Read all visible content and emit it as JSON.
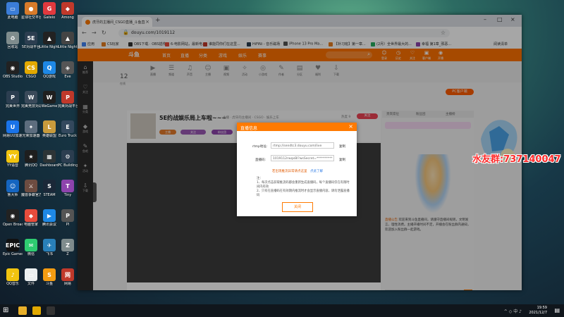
{
  "desktop_icons": [
    {
      "label": "此电脑",
      "color": "#3b7dd8",
      "glyph": "▭"
    },
    {
      "label": "星球社交平台",
      "color": "#d87b2a",
      "glyph": "●"
    },
    {
      "label": "Gateio",
      "color": "#e0393e",
      "glyph": "G"
    },
    {
      "label": "Among",
      "color": "#c0392b",
      "glyph": "◆"
    },
    {
      "label": "回收站",
      "color": "#7f8c8d",
      "glyph": "♻"
    },
    {
      "label": "5E对战平台",
      "color": "#2c3e50",
      "glyph": "5E"
    },
    {
      "label": "Little Nightmares",
      "color": "#222222",
      "glyph": "▲"
    },
    {
      "label": "Little Nightmares 2",
      "color": "#444444",
      "glyph": "▲"
    },
    {
      "label": "OBS Studio",
      "color": "#222222",
      "glyph": "◉"
    },
    {
      "label": "CSGO",
      "color": "#e2a900",
      "glyph": "CS"
    },
    {
      "label": "QQ游戏",
      "color": "#1e88e5",
      "glyph": "Q"
    },
    {
      "label": "Eve",
      "color": "#555555",
      "glyph": "◈"
    },
    {
      "label": "完美世界",
      "color": "#2c3e50",
      "glyph": "P"
    },
    {
      "label": "完美竞技对战平台",
      "color": "#3a4a5a",
      "glyph": "W"
    },
    {
      "label": "WeGame",
      "color": "#1f1f1f",
      "glyph": "W"
    },
    {
      "label": "完美对战平台",
      "color": "#c0392b",
      "glyph": "P"
    },
    {
      "label": "网易UU加速器",
      "color": "#1a73e8",
      "glyph": "U"
    },
    {
      "label": "光荣加速器",
      "color": "#5d6d7e",
      "glyph": "✦"
    },
    {
      "label": "英雄联盟",
      "color": "#c89b3c",
      "glyph": "L"
    },
    {
      "label": "Euro Truck",
      "color": "#34495e",
      "glyph": "E"
    },
    {
      "label": "YY语音",
      "color": "#f1c40f",
      "glyph": "YY"
    },
    {
      "label": "腾讯QQ",
      "color": "#1e1e1e",
      "glyph": "★"
    },
    {
      "label": "Dashboard",
      "color": "#2d3436",
      "glyph": "▦"
    },
    {
      "label": "PC Building",
      "color": "#2c3e50",
      "glyph": "⚙"
    },
    {
      "label": "鲁大师",
      "color": "#1565c0",
      "glyph": "☺"
    },
    {
      "label": "魔兽争霸官方对战平台",
      "color": "#6d4c41",
      "glyph": "⚔"
    },
    {
      "label": "STEAM",
      "color": "#1b2838",
      "glyph": "S"
    },
    {
      "label": "Tiny",
      "color": "#8e44ad",
      "glyph": "T"
    },
    {
      "label": "Open Broadcaster",
      "color": "#222222",
      "glyph": "◉"
    },
    {
      "label": "电脑管家",
      "color": "#e74c3c",
      "glyph": "◆"
    },
    {
      "label": "腾讯会议",
      "color": "#1e88e5",
      "glyph": "▶"
    },
    {
      "label": "Pl",
      "color": "#555555",
      "glyph": "P"
    },
    {
      "label": "Epic Games Launcher",
      "color": "#111111",
      "glyph": "EPIC"
    },
    {
      "label": "微信",
      "color": "#2ecc71",
      "glyph": "✉"
    },
    {
      "label": "飞书",
      "color": "#2980b9",
      "glyph": "✈"
    },
    {
      "label": "Z",
      "color": "#7f8c8d",
      "glyph": "Z"
    },
    {
      "label": "QQ音乐",
      "color": "#f1c40f",
      "glyph": "♪"
    },
    {
      "label": "文件",
      "color": "#ecf0f1",
      "glyph": "▭"
    },
    {
      "label": "斗鱼",
      "color": "#f39c12",
      "glyph": "S"
    },
    {
      "label": "网易",
      "color": "#c0392b",
      "glyph": "网"
    }
  ],
  "browser": {
    "tab_title": "虎牙的主播间_CSGO直播_斗鱼直播",
    "url": "douyu.com/1019112",
    "bookmarks": [
      {
        "label": "应用",
        "color": "#4285f4"
      },
      {
        "label": "CS玩家",
        "color": "#e67e22"
      },
      {
        "label": "OBS下载 · OBS插件...",
        "color": "#333333"
      },
      {
        "label": "6-电影网站，最新电...",
        "color": "#e74c3c"
      },
      {
        "label": "谁能同你们在这里...",
        "color": "#c0392b"
      },
      {
        "label": "HiFiNi - 音乐磁场",
        "color": "#2c3e50"
      },
      {
        "label": "iPhone 13 Pro Ma...",
        "color": "#555555"
      },
      {
        "label": "【补习班】第一章...",
        "color": "#e67e22"
      },
      {
        "label": "(2月）全世界最大的...",
        "color": "#27ae60"
      },
      {
        "label": "幸福 第1章_邪恶...",
        "color": "#8e44ad"
      }
    ],
    "reading_list": "阅读清单"
  },
  "site": {
    "logo": "斗鱼",
    "nav": [
      "首页",
      "直播",
      "分类",
      "游戏",
      "娱乐",
      "赛事"
    ],
    "header_right": [
      "登录",
      "历史",
      "关注",
      "客户端",
      "开播"
    ],
    "left_rail": [
      "推荐",
      "关注",
      "分类",
      "游戏",
      "鱼吧",
      "活动",
      "下载"
    ],
    "category_count": "12",
    "category_label": "在线",
    "categories": [
      "直播",
      "频道",
      "声音",
      "主播",
      "视频",
      "活动",
      "小游戏",
      "作者",
      "分区",
      "福利",
      "下载"
    ],
    "pc_badge": "PC客户端",
    "room": {
      "title": "5E约战娱乐局上车啦~~~",
      "meta": "主播 · 虎牙的主播间 · CSGO · 娱乐上车",
      "hot": "热度 9",
      "follow": "关注",
      "tags": [
        "主播",
        "关注",
        "粉丝团",
        "送礼物"
      ]
    },
    "right_tabs": [
      "贵宾席位",
      "粉丝团",
      "主播榜"
    ],
    "notice_label": "直播公告",
    "notice_text": "欢迎来到斗鱼直播间，请遵守直播间规则，文明发言，理性消费。主播开播时间不定，开播会在粉丝群内通知，欢迎加入粉丝群一起游戏。"
  },
  "dialog": {
    "title": "直播信息",
    "rtmp_label": "rtmp地址:",
    "rtmp_value": "rtmp://sendtc3.douyu.com/live",
    "copy1": "复制",
    "key_label": "直播码:",
    "key_value": "1019112rwqxBl?wsSecret=**********",
    "copy2": "复制",
    "hint": "若出现推流异常请点这里",
    "hint_link": "点此了解",
    "notes": [
      "注：",
      "1、每次点击获取推流码都会重新生成直播码，每个直播码仅在有限时间内有效",
      "2、只有在直播码在有效期内推流时才会显示直播内容，请勿泄露直播码"
    ],
    "close_button": "关闭"
  },
  "qq_group": "水友群:737140047",
  "taskbar": {
    "time": "19:59",
    "date": "2021/12/7",
    "tray": "^  ◇  中  ♪"
  }
}
